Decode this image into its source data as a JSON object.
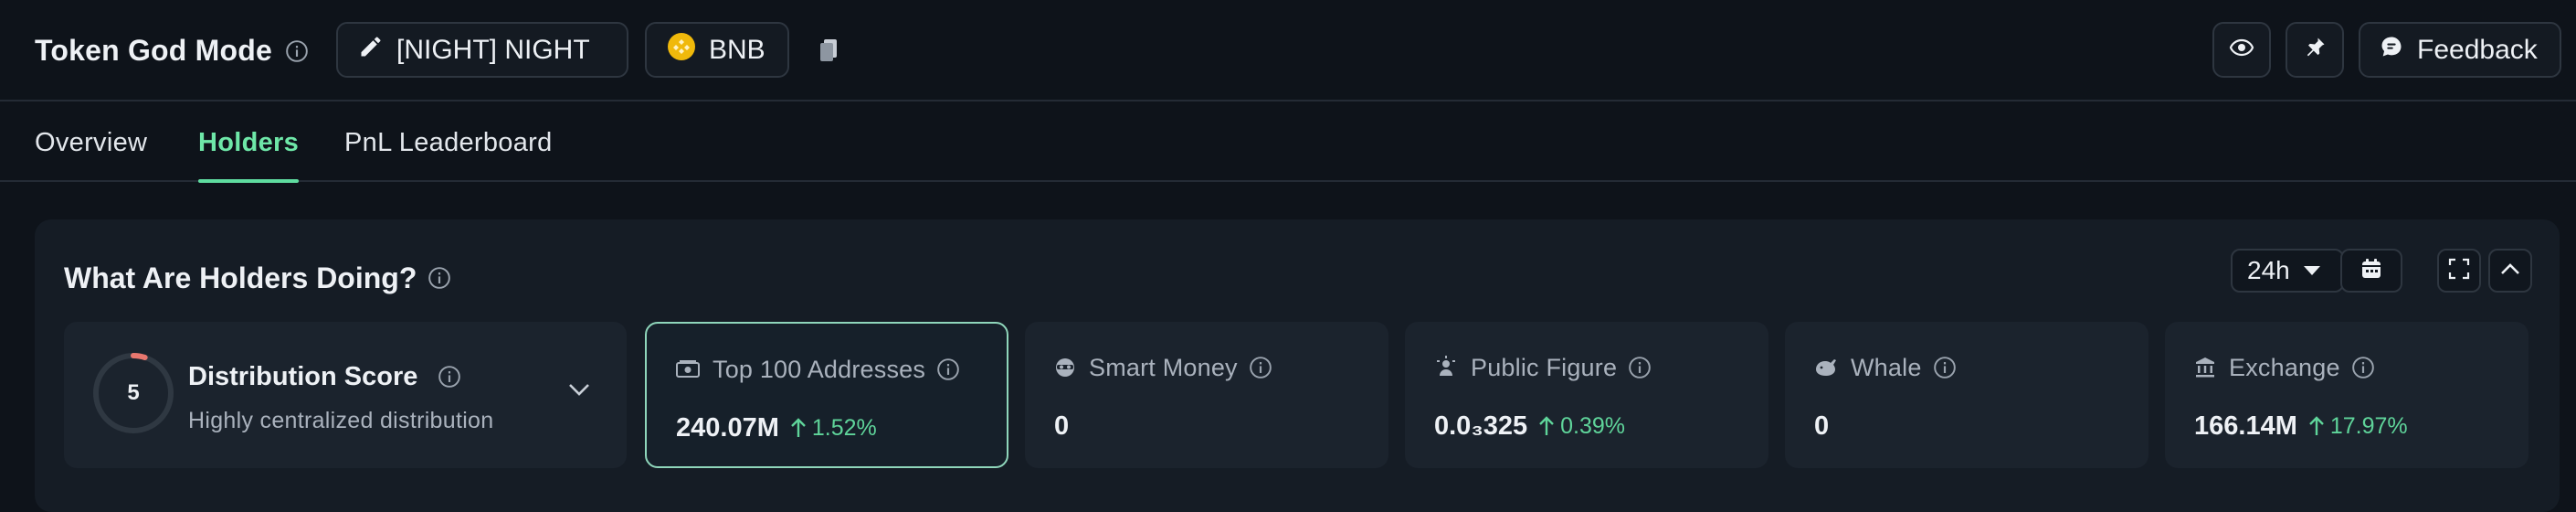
{
  "header": {
    "title": "Token God Mode",
    "token_name": "[NIGHT] NIGHT",
    "chain": "BNB",
    "feedback_label": "Feedback"
  },
  "tabs": [
    {
      "label": "Overview",
      "active": false
    },
    {
      "label": "Holders",
      "active": true
    },
    {
      "label": "PnL Leaderboard",
      "active": false
    }
  ],
  "panel": {
    "title": "What Are Holders Doing?",
    "time_range": "24h"
  },
  "distribution": {
    "score": "5",
    "score_fraction": 0.05,
    "title": "Distribution Score",
    "subtitle": "Highly centralized distribution"
  },
  "cards": [
    {
      "label": "Top 100 Addresses",
      "icon": "cash-icon",
      "value": "240.07M",
      "change": "1.52%",
      "selected": true
    },
    {
      "label": "Smart Money",
      "icon": "spy-icon",
      "value": "0",
      "change": ""
    },
    {
      "label": "Public Figure",
      "icon": "figure-icon",
      "value": "0.0₃325",
      "change": "0.39%"
    },
    {
      "label": "Whale",
      "icon": "whale-icon",
      "value": "0",
      "change": ""
    },
    {
      "label": "Exchange",
      "icon": "bank-icon",
      "value": "166.14M",
      "change": "17.97%"
    }
  ],
  "colors": {
    "accent_green": "#6ee7a8",
    "positive_change": "#5fd49a",
    "bnb_yellow": "#f0b90b",
    "score_red": "#e8776f"
  }
}
